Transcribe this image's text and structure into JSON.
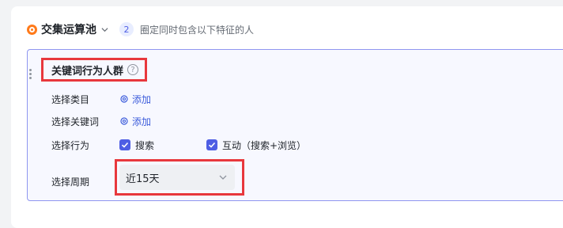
{
  "header": {
    "operator_label": "交集运算池",
    "count": "2",
    "hint": "圈定同时包含以下特征的人"
  },
  "panel": {
    "title": "关键词行为人群",
    "help": "?",
    "rows": {
      "category_label": "选择类目",
      "keyword_label": "选择关键词",
      "behavior_label": "选择行为",
      "period_label": "选择周期"
    },
    "add_label": "添加",
    "behaviors": [
      {
        "label": "搜索",
        "checked": true
      },
      {
        "label": "互动（搜索+浏览）",
        "checked": true
      }
    ],
    "period_value": "近15天"
  },
  "colors": {
    "accent": "#4e5ee4",
    "highlight_box": "#e8383d",
    "operator": "#ff7a1a"
  }
}
